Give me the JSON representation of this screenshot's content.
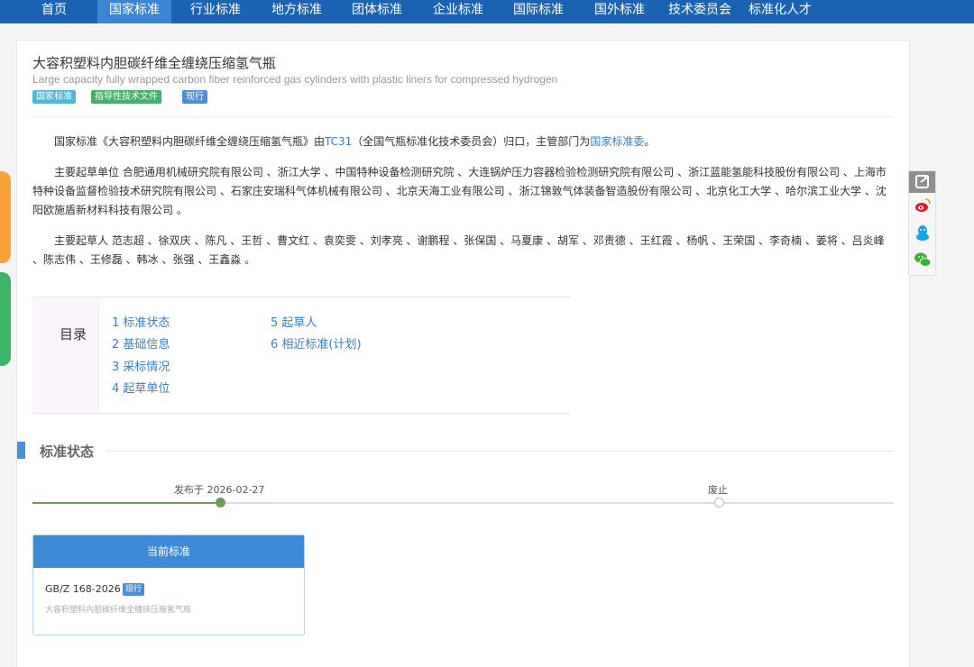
{
  "nav": [
    "首页",
    "国家标准",
    "行业标准",
    "地方标准",
    "团体标准",
    "企业标准",
    "国际标准",
    "国外标准",
    "技术委员会",
    "标准化人才"
  ],
  "title_cn": "大容积塑料内胆碳纤维全缠绕压缩氢气瓶",
  "title_en": "Large capacity fully wrapped carbon fiber reinforced gas cylinders with plastic liners for compressed hydrogen",
  "tags": [
    "国家标准",
    "指导性技术文件",
    "现行"
  ],
  "intro": {
    "pre": "国家标准《大容积塑料内胆碳纤维全缠绕压缩氢气瓶》由",
    "tc": "TC31",
    "mid": "（全国气瓶标准化技术委员会）归口，主管部门为",
    "dept": "国家标准委",
    "post": "。"
  },
  "drafting_units": "主要起草单位 合肥通用机械研究院有限公司 、浙江大学 、中国特种设备检测研究院 、大连锅炉压力容器检验检测研究院有限公司 、浙江蓝能氢能科技股份有限公司 、上海市特种设备监督检验技术研究院有限公司 、石家庄安瑞科气体机械有限公司 、北京天海工业有限公司 、浙江锦敦气体装备智造股份有限公司 、北京化工大学 、哈尔滨工业大学 、沈阳欧施盾新材料科技有限公司 。",
  "drafters": "主要起草人 范志超 、徐双庆 、陈凡 、王哲 、曹文红 、袁奕雯 、刘孝亮 、谢鹏程 、张保国 、马夏康 、胡军 、邓贵德 、王红霞 、杨帆 、王荣国 、李奇楠 、姜将 、吕炎峰 、陈志伟 、王修磊 、韩冰 、张强 、王鑫淼 。",
  "toc": {
    "label": "目录",
    "items": [
      "1 标准状态",
      "2 基础信息",
      "3 采标情况",
      "4 起草单位",
      "5 起草人",
      "6 相近标准(计划)"
    ]
  },
  "section_title": "标准状态",
  "timeline": {
    "published": "发布于 2026-02-27",
    "abolished": "废止"
  },
  "current": {
    "header": "当前标准",
    "code": "GB/Z 168-2026",
    "badge": "现行",
    "name": "大容积塑料内胆碳纤维全缠绕压缩氢气瓶"
  }
}
